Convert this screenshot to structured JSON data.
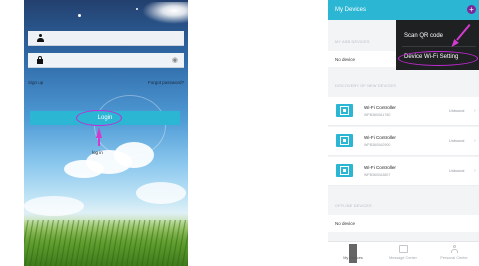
{
  "login_screen": {
    "username_placeholder": "",
    "password_placeholder": "",
    "signup_label": "Sign up",
    "forgot_label": "Forgot password?",
    "login_button": "Login",
    "annotation_caption": "log in"
  },
  "devices_screen": {
    "title": "My Devices",
    "add_symbol": "+",
    "menu": {
      "items": [
        "Scan QR code",
        "Device Wi-Fi Setting"
      ]
    },
    "my_devices": {
      "header": "MY ASB DEVICES",
      "empty_text": "No device"
    },
    "discovered": {
      "header": "DISCOVERY OF NEW DEVICES",
      "devices": [
        {
          "name": "Wi-Fi Controller",
          "id": "WFB3600A1780",
          "status": "Unbound"
        },
        {
          "name": "Wi-Fi Controller",
          "id": "WFB3600A2900",
          "status": "Unbound"
        },
        {
          "name": "Wi-Fi Controller",
          "id": "WFB3600A3807",
          "status": "Unbound"
        }
      ]
    },
    "offline": {
      "header": "OFFLINE DEVICES",
      "empty_text": "No device"
    },
    "bottom_nav": [
      {
        "label": "My Devices",
        "icon": "devices-grid-icon",
        "active": true
      },
      {
        "label": "Message Center",
        "icon": "message-icon",
        "active": false
      },
      {
        "label": "Personal Center",
        "icon": "person-icon",
        "active": false
      }
    ]
  },
  "colors": {
    "accent": "#2bb6d3",
    "annotation": "#c52bd8",
    "menu_bg": "#1f2022"
  }
}
